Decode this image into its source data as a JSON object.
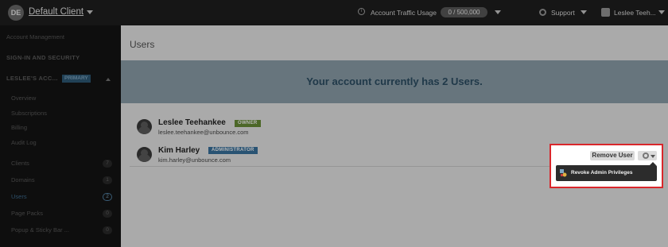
{
  "topbar": {
    "client_initials": "DE",
    "client_name": "Default Client",
    "traffic_label": "Account Traffic Usage",
    "traffic_value": "0 / 500,000",
    "support_label": "Support",
    "user_name": "Leslee Teeh..."
  },
  "sidebar": {
    "account_management": "Account Management",
    "signin_security": "SIGN-IN AND SECURITY",
    "account_label": "LESLEE'S ACC...",
    "primary_badge": "PRIMARY",
    "items": [
      {
        "label": "Overview"
      },
      {
        "label": "Subscriptions"
      },
      {
        "label": "Billing"
      },
      {
        "label": "Audit Log"
      },
      {
        "label": "Clients",
        "count": "7"
      },
      {
        "label": "Domains",
        "count": "1"
      },
      {
        "label": "Users",
        "count": "2"
      },
      {
        "label": "Page Packs",
        "count": "0"
      },
      {
        "label": "Popup & Sticky Bar ...",
        "count": "0"
      }
    ]
  },
  "main": {
    "title": "Users",
    "banner": "Your account currently has 2 Users.",
    "users": [
      {
        "name": "Leslee Teehankee",
        "role": "OWNER",
        "email": "leslee.teehankee@unbounce.com"
      },
      {
        "name": "Kim Harley",
        "role": "ADMINISTRATOR",
        "email": "kim.harley@unbounce.com"
      }
    ],
    "remove_user_label": "Remove User",
    "menu_item": "Revoke Admin Privileges"
  },
  "colors": {
    "accent_blue": "#3a74a0",
    "owner_green": "#6a8f38",
    "highlight_red": "#d9262b"
  }
}
